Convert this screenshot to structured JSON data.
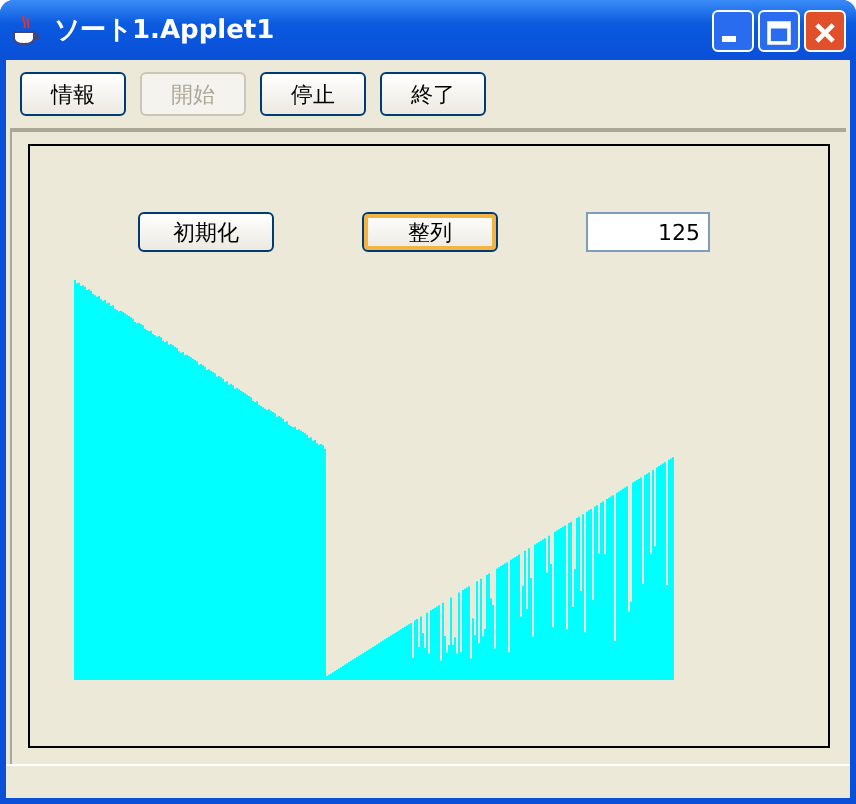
{
  "window": {
    "title": "ソート1.Applet1"
  },
  "toolbar": [
    {
      "label": "情報",
      "disabled": false
    },
    {
      "label": "開始",
      "disabled": true
    },
    {
      "label": "停止",
      "disabled": false
    },
    {
      "label": "終了",
      "disabled": false
    }
  ],
  "panel": {
    "buttons": [
      {
        "label": "初期化",
        "focused": false
      },
      {
        "label": "整列",
        "focused": true
      }
    ],
    "count_field": {
      "value": "125"
    }
  }
}
